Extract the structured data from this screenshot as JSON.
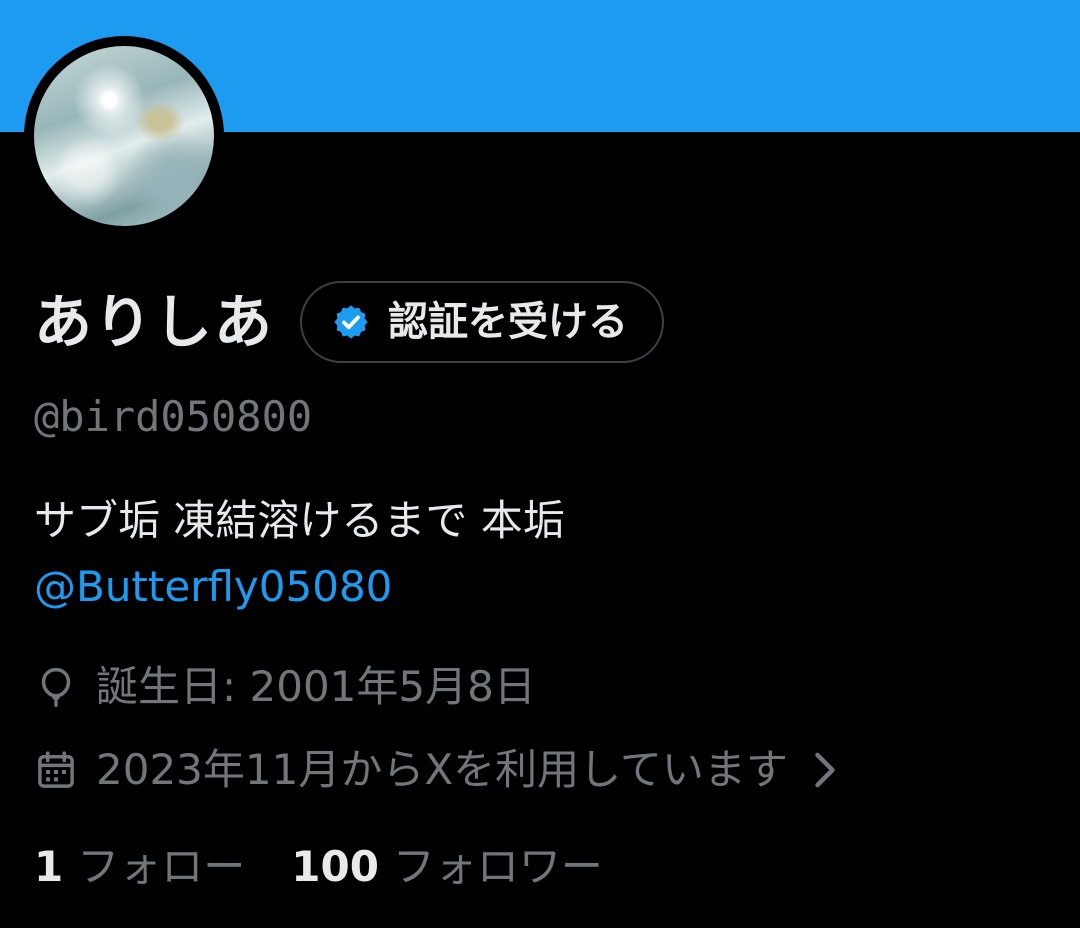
{
  "profile": {
    "display_name": "ありしあ",
    "verify_button_label": "認証を受ける",
    "handle": "@bird050800",
    "bio_text": "サブ垢 凍結溶けるまで 本垢",
    "bio_link": "@Butterfly05080",
    "birthday": "誕生日: 2001年5月8日",
    "joined": "2023年11月からXを利用しています",
    "following_count": "1",
    "following_label": "フォロー",
    "followers_count": "100",
    "followers_label": "フォロワー"
  },
  "icons": {
    "verify": "verified-badge-icon",
    "birthday": "balloon-icon",
    "joined": "calendar-icon",
    "more": "chevron-right-icon"
  },
  "colors": {
    "banner": "#1d9bf0",
    "background": "#000000",
    "accent": "#1d9bf0",
    "primary_text": "#e7e9ea",
    "secondary_text": "#71767b"
  }
}
